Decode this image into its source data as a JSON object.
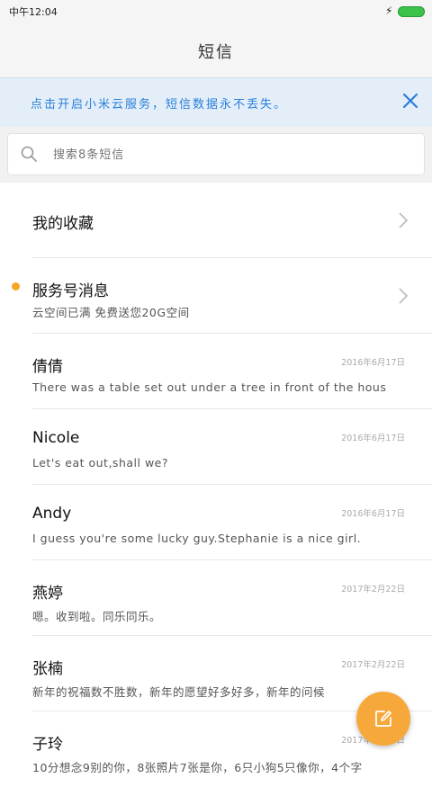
{
  "status_bar": {
    "time": "中午12:04",
    "charging_icon": "lightning-icon",
    "battery_color": "#3bc24a"
  },
  "header": {
    "title": "短信"
  },
  "banner": {
    "text": "点击开启小米云服务，短信数据永不丢失。",
    "close_icon": "close-icon",
    "accent": "#2b7fd9"
  },
  "search": {
    "placeholder": "搜索8条短信",
    "icon": "search-icon"
  },
  "list": [
    {
      "title": "我的收藏",
      "preview": "",
      "date": "",
      "chevron": true,
      "unread": false
    },
    {
      "title": "服务号消息",
      "preview": "云空间已满 免费送您20G空间",
      "date": "",
      "chevron": true,
      "unread": true
    },
    {
      "title": "倩倩",
      "preview": "There was a table set out under a tree in front of the hous",
      "date": "2016年6月17日",
      "chevron": false,
      "unread": false
    },
    {
      "title": "Nicole",
      "preview": "Let's eat out,shall we?",
      "date": "2016年6月17日",
      "chevron": false,
      "unread": false
    },
    {
      "title": "Andy",
      "preview": "I guess you're some lucky guy.Stephanie is a nice girl.",
      "date": "2016年6月17日",
      "chevron": false,
      "unread": false
    },
    {
      "title": "燕婷",
      "preview": "嗯。收到啦。同乐同乐。",
      "date": "2017年2月22日",
      "chevron": false,
      "unread": false
    },
    {
      "title": "张楠",
      "preview": "新年的祝福数不胜数，新年的愿望好多好多，新年的问候",
      "date": "2017年2月22日",
      "chevron": false,
      "unread": false
    },
    {
      "title": "子玲",
      "preview": "10分想念9别的你，8张照片7张是你，6只小狗5只像你，4个字",
      "date": "2017年2月22日",
      "chevron": false,
      "unread": false
    }
  ],
  "fab": {
    "icon": "compose-icon",
    "color": "#f6a83a"
  }
}
